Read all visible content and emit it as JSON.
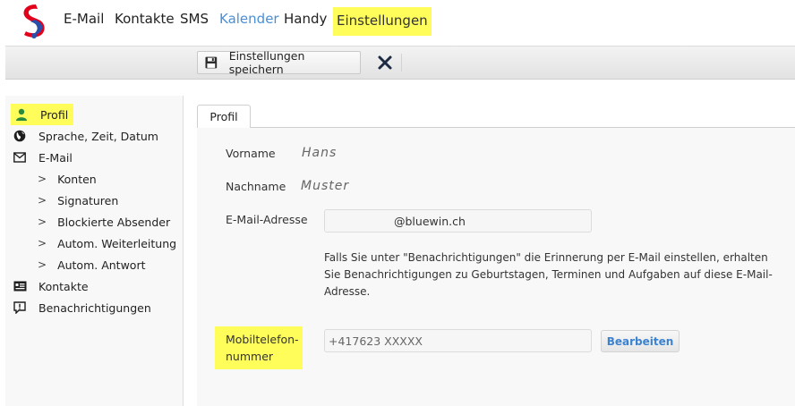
{
  "nav": {
    "items": [
      {
        "label": "E-Mail"
      },
      {
        "label": "Kontakte"
      },
      {
        "label": "SMS"
      },
      {
        "label": "Kalender"
      },
      {
        "label": "Handy"
      },
      {
        "label": "Einstellungen"
      }
    ]
  },
  "toolbar": {
    "save_label": "Einstellungen speichern",
    "save_icon": "floppy-disk-icon",
    "close_icon": "close-icon"
  },
  "sidebar": {
    "items": [
      {
        "label": "Profil",
        "icon": "person-icon"
      },
      {
        "label": "Sprache, Zeit, Datum",
        "icon": "globe-icon"
      },
      {
        "label": "E-Mail",
        "icon": "envelope-icon"
      },
      {
        "label": "Konten"
      },
      {
        "label": "Signaturen"
      },
      {
        "label": "Blockierte Absender"
      },
      {
        "label": "Autom. Weiterleitung"
      },
      {
        "label": "Autom. Antwort"
      },
      {
        "label": "Kontakte",
        "icon": "contact-card-icon"
      },
      {
        "label": "Benachrichtigungen",
        "icon": "notification-icon"
      }
    ]
  },
  "profile": {
    "tab_label": "Profil",
    "first_name_label": "Vorname",
    "first_name_value": "Hans",
    "last_name_label": "Nachname",
    "last_name_value": "Muster",
    "email_label": "E-Mail-Adresse",
    "email_value": "@bluewin.ch",
    "email_note": "Falls Sie unter \"Benachrichtigungen\" die Erinnerung per E-Mail einstellen, erhalten Sie Benachrichtigungen zu Geburtstagen, Terminen und Aufgaben auf diese E-Mail-Adresse.",
    "mobile_label_line1": "Mobiltelefon-",
    "mobile_label_line2": "nummer",
    "mobile_value": "+417623 XXXXX",
    "edit_button": "Bearbeiten"
  },
  "colors": {
    "highlight": "#fffd5a",
    "accent_blue": "#4a8fd6",
    "logo_red": "#e3001b",
    "logo_blue": "#2a4fa8"
  }
}
